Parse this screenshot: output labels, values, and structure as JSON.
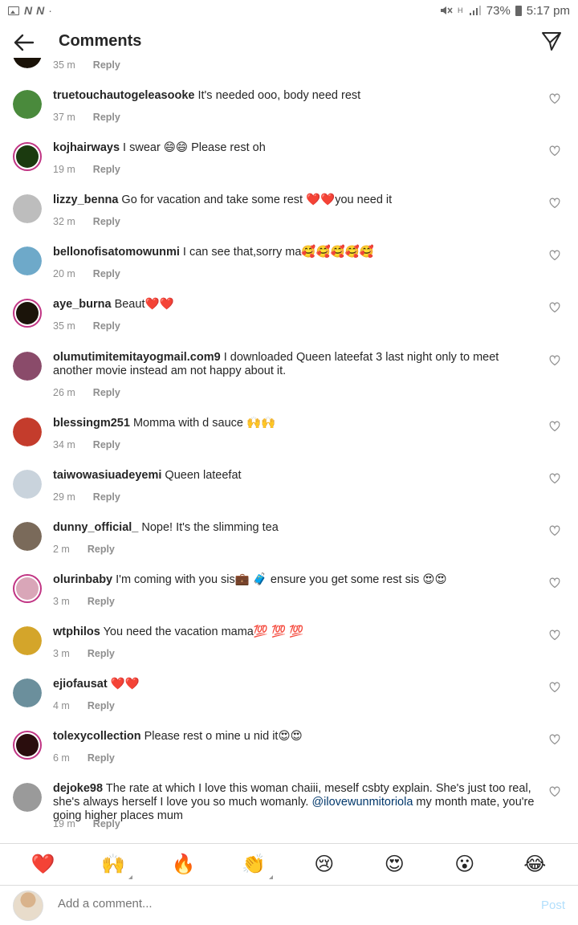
{
  "status_bar": {
    "left_icons": [
      "image-icon",
      "N",
      "N",
      "·"
    ],
    "battery": "73%",
    "time": "5:17 pm"
  },
  "header": {
    "title": "Comments"
  },
  "reply_label": "Reply",
  "comments": [
    {
      "user": "",
      "text": "",
      "time": "35 m",
      "avatar_color": "#1a1208"
    },
    {
      "user": "truetouchautogeleasooke",
      "text": " It's needed ooo, body need rest",
      "time": "37 m",
      "avatar_color": "#4a8a3c"
    },
    {
      "user": "kojhairways",
      "text": " I swear 😄😄 Please rest oh",
      "time": "19 m",
      "avatar_color": "#1b3a0f",
      "ring": true
    },
    {
      "user": "lizzy_benna",
      "text": " Go for vacation and take some rest ❤️❤️you need it",
      "time": "32 m",
      "avatar_color": "#bdbdbd"
    },
    {
      "user": "bellonofisatomowunmi",
      "text": " I can see that,sorry ma🥰🥰🥰🥰🥰",
      "time": "20 m",
      "avatar_color": "#6ea9c9"
    },
    {
      "user": "aye_burna",
      "text": " Beaut❤️❤️",
      "time": "35 m",
      "avatar_color": "#1b140a",
      "ring": true
    },
    {
      "user": "olumutimitemitayogmail.com9",
      "text": " I downloaded Queen lateefat 3 last night only to meet another movie instead am not happy about it.",
      "time": "26 m",
      "avatar_color": "#8a4b6a"
    },
    {
      "user": "blessingm251",
      "text": " Momma with d sauce 🙌🙌",
      "time": "34 m",
      "avatar_color": "#c43c2c"
    },
    {
      "user": "taiwowasiuadeyemi",
      "text": " Queen lateefat",
      "time": "29 m",
      "avatar_color": "#c9d3dc"
    },
    {
      "user": "dunny_official_",
      "text": " Nope! It's the slimming tea",
      "time": "2 m",
      "avatar_color": "#7a6a5a"
    },
    {
      "user": "olurinbaby",
      "text": " I'm coming with you sis💼 🧳 ensure you get some rest sis 😍😍",
      "time": "3 m",
      "avatar_color": "#d9a6b8",
      "ring": true
    },
    {
      "user": "wtphilos",
      "text": " You need the vacation mama💯 💯 💯",
      "time": "3 m",
      "avatar_color": "#d4a52a"
    },
    {
      "user": "ejiofausat",
      "text": " ❤️❤️",
      "time": "4 m",
      "avatar_color": "#6b8f9c"
    },
    {
      "user": "tolexycollection",
      "text": " Please rest o mine u nid it😍😍",
      "time": "6 m",
      "avatar_color": "#2a0d0d",
      "ring": true
    },
    {
      "user": "dejoke98",
      "text": " The rate at which I love this woman chaiii, meself csbty explain. She's just too real, she's always herself I love you so much womanly. ",
      "mention": "@ilovewunmitoriola",
      "text_after": " my month mate, you're going higher places mum",
      "time": "19 m",
      "avatar_color": "#9a9a9a"
    }
  ],
  "reactions": [
    "❤️",
    "🙌",
    "🔥",
    "👏",
    "😢",
    "😍",
    "😮",
    "😂"
  ],
  "composer": {
    "placeholder": "Add a comment...",
    "post_label": "Post"
  }
}
